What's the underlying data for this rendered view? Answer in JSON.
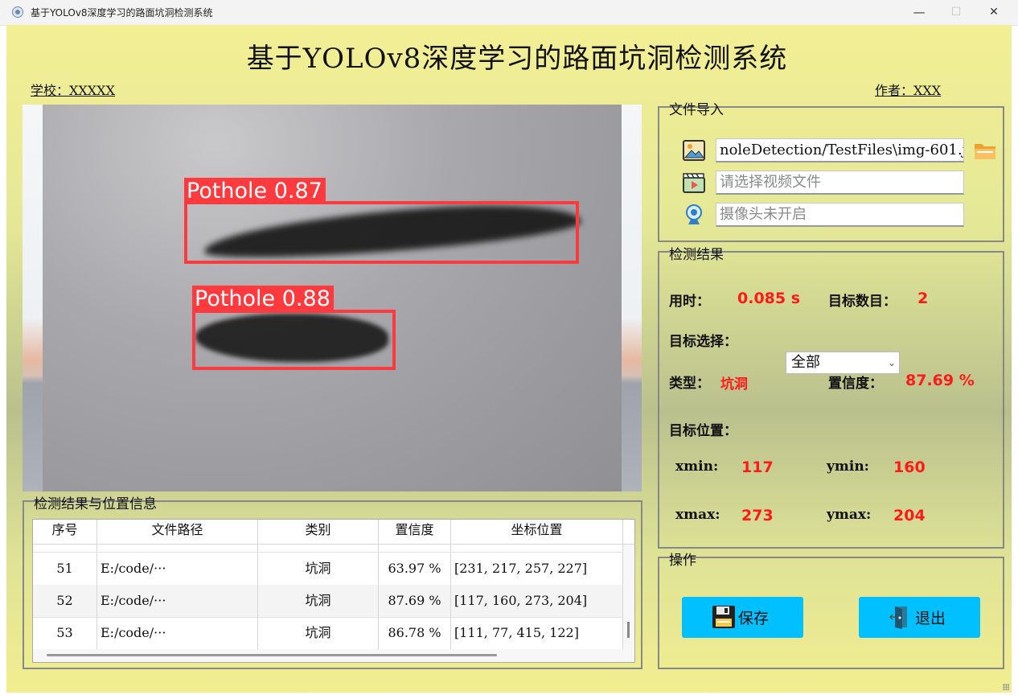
{
  "window": {
    "title": "基于YOLOv8深度学习的路面坑洞检测系统",
    "minimize_glyph": "—",
    "maximize_glyph": "☐",
    "close_glyph": "✕"
  },
  "header": {
    "title": "基于YOLOv8深度学习的路面坑洞检测系统",
    "school": "学校：XXXXX",
    "author": "作者：XXX"
  },
  "image": {
    "detections": [
      {
        "label": "Pothole 0.87"
      },
      {
        "label": "Pothole 0.88"
      }
    ]
  },
  "file_import": {
    "title": "文件导入",
    "image_path": "noleDetection/TestFiles\\img-601.jpg",
    "video_placeholder": "请选择视频文件",
    "camera_placeholder": "摄像头未开启",
    "icons": [
      "image-icon",
      "video-icon",
      "camera-icon",
      "folder-icon"
    ]
  },
  "detection": {
    "title": "检测结果",
    "time_label": "用时：",
    "time_value": "0.085 s",
    "count_label": "目标数目：",
    "count_value": "2",
    "select_label": "目标选择：",
    "select_value": "全部",
    "type_label": "类型：",
    "type_value": "坑洞",
    "conf_label": "置信度：",
    "conf_value": "87.69 %",
    "pos_label": "目标位置：",
    "xmin_label": "xmin:",
    "xmin_value": "117",
    "ymin_label": "ymin:",
    "ymin_value": "160",
    "xmax_label": "xmax:",
    "xmax_value": "273",
    "ymax_label": "ymax:",
    "ymax_value": "204"
  },
  "operations": {
    "title": "操作",
    "save_label": "保存",
    "exit_label": "退出"
  },
  "table": {
    "title": "检测结果与位置信息",
    "headers": [
      "序号",
      "文件路径",
      "类别",
      "置信度",
      "坐标位置"
    ],
    "rows": [
      [
        "51",
        "E:/code/···",
        "坑洞",
        "63.97 %",
        "[231, 217, 257, 227]"
      ],
      [
        "52",
        "E:/code/···",
        "坑洞",
        "87.69 %",
        "[117, 160, 273, 204]"
      ],
      [
        "53",
        "E:/code/···",
        "坑洞",
        "86.78 %",
        "[111, 77, 415, 122]"
      ]
    ]
  },
  "colors": {
    "bbox": "#ff3a3f",
    "value_red": "#ff1a1a",
    "button": "#00c0ff"
  }
}
